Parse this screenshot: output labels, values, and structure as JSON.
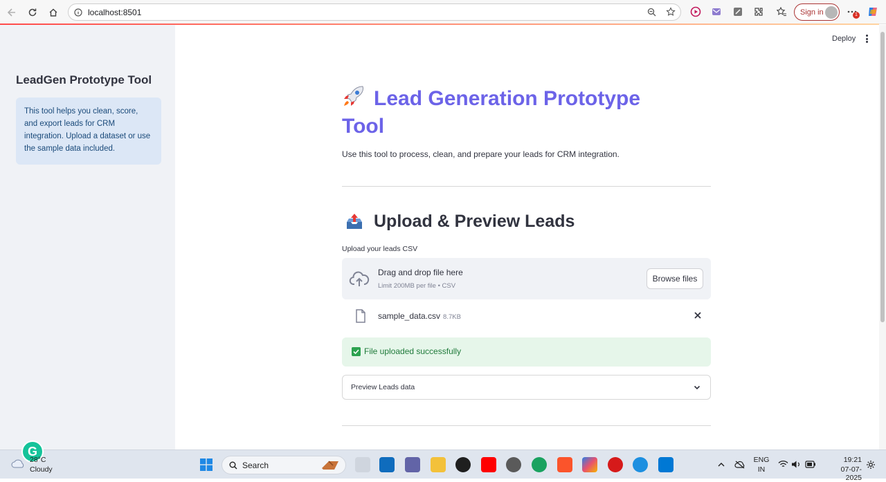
{
  "browser": {
    "url": "localhost:8501",
    "signin_label": "Sign in",
    "notification_count": "1"
  },
  "sidebar": {
    "title": "LeadGen Prototype Tool",
    "info": "This tool helps you clean, score, and export leads for CRM integration. Upload a dataset or use the sample data included."
  },
  "header": {
    "deploy_label": "Deploy"
  },
  "main": {
    "title": "Lead Generation Prototype Tool",
    "subtitle": "Use this tool to process, clean, and prepare your leads for CRM integration.",
    "section_title": "Upload & Preview Leads",
    "upload_label": "Upload your leads CSV",
    "dropzone_title": "Drag and drop file here",
    "dropzone_sub": "Limit 200MB per file • CSV",
    "browse_label": "Browse files",
    "file_name": "sample_data.csv",
    "file_size": "8.7KB",
    "success_message": "File uploaded successfully",
    "expander_label": "Preview Leads data"
  },
  "taskbar": {
    "weather_temp": "28°C",
    "weather_desc": "Cloudy",
    "search_label": "Search",
    "lang_top": "ENG",
    "lang_bottom": "IN",
    "time": "19:21",
    "date": "07-07-2025"
  },
  "colors": {
    "accent_title": "#6c63e8",
    "sidebar_bg": "#f0f2f6",
    "info_bg": "#dce7f6",
    "success_bg": "#e6f6ea",
    "success_text": "#1f7a3a"
  }
}
